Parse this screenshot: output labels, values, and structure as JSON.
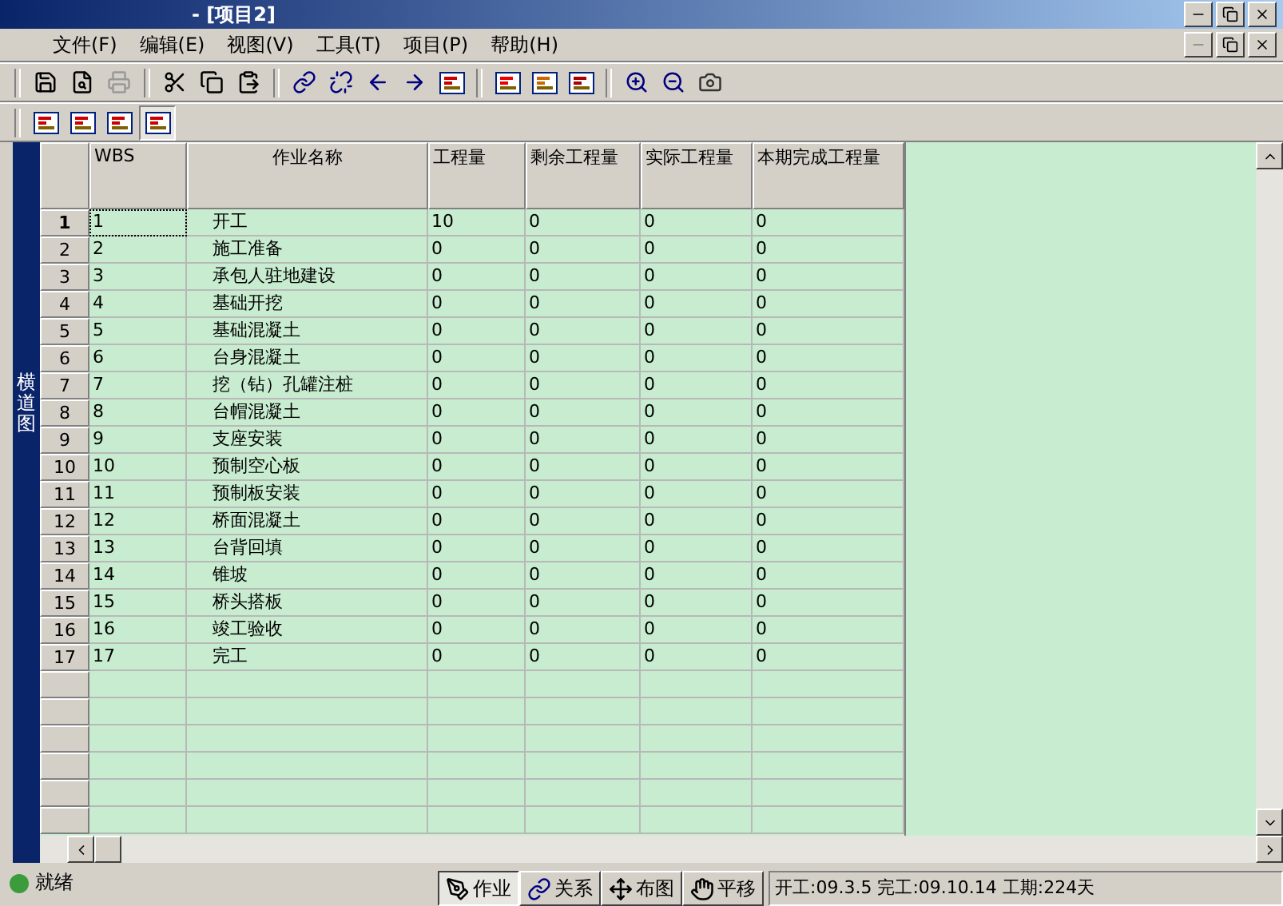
{
  "window": {
    "title": "- [项目2]"
  },
  "menu": [
    "文件(F)",
    "编辑(E)",
    "视图(V)",
    "工具(T)",
    "项目(P)",
    "帮助(H)"
  ],
  "view_toolbar": [
    {
      "pressed": false
    },
    {
      "pressed": false
    },
    {
      "pressed": false
    },
    {
      "pressed": true
    }
  ],
  "side_panel": {
    "label": "横道图"
  },
  "table": {
    "columns": [
      "WBS",
      "作业名称",
      "工程量",
      "剩余工程量",
      "实际工程量",
      "本期完成工程量"
    ],
    "rows": [
      {
        "number": "1",
        "cells": [
          "1",
          "开工",
          "10",
          "0",
          "0",
          "0"
        ],
        "selected": true
      },
      {
        "number": "2",
        "cells": [
          "2",
          "施工准备",
          "0",
          "0",
          "0",
          "0"
        ],
        "selected": false
      },
      {
        "number": "3",
        "cells": [
          "3",
          "承包人驻地建设",
          "0",
          "0",
          "0",
          "0"
        ],
        "selected": false
      },
      {
        "number": "4",
        "cells": [
          "4",
          "基础开挖",
          "0",
          "0",
          "0",
          "0"
        ],
        "selected": false
      },
      {
        "number": "5",
        "cells": [
          "5",
          "基础混凝土",
          "0",
          "0",
          "0",
          "0"
        ],
        "selected": false
      },
      {
        "number": "6",
        "cells": [
          "6",
          "台身混凝土",
          "0",
          "0",
          "0",
          "0"
        ],
        "selected": false
      },
      {
        "number": "7",
        "cells": [
          "7",
          "挖（钻）孔罐注桩",
          "0",
          "0",
          "0",
          "0"
        ],
        "selected": false
      },
      {
        "number": "8",
        "cells": [
          "8",
          "台帽混凝土",
          "0",
          "0",
          "0",
          "0"
        ],
        "selected": false
      },
      {
        "number": "9",
        "cells": [
          "9",
          "支座安装",
          "0",
          "0",
          "0",
          "0"
        ],
        "selected": false
      },
      {
        "number": "10",
        "cells": [
          "10",
          "预制空心板",
          "0",
          "0",
          "0",
          "0"
        ],
        "selected": false
      },
      {
        "number": "11",
        "cells": [
          "11",
          "预制板安装",
          "0",
          "0",
          "0",
          "0"
        ],
        "selected": false
      },
      {
        "number": "12",
        "cells": [
          "12",
          "桥面混凝土",
          "0",
          "0",
          "0",
          "0"
        ],
        "selected": false
      },
      {
        "number": "13",
        "cells": [
          "13",
          "台背回填",
          "0",
          "0",
          "0",
          "0"
        ],
        "selected": false
      },
      {
        "number": "14",
        "cells": [
          "14",
          "锥坡",
          "0",
          "0",
          "0",
          "0"
        ],
        "selected": false
      },
      {
        "number": "15",
        "cells": [
          "15",
          "桥头搭板",
          "0",
          "0",
          "0",
          "0"
        ],
        "selected": false
      },
      {
        "number": "16",
        "cells": [
          "16",
          "竣工验收",
          "0",
          "0",
          "0",
          "0"
        ],
        "selected": false
      },
      {
        "number": "17",
        "cells": [
          "17",
          "完工",
          "0",
          "0",
          "0",
          "0"
        ],
        "selected": false
      }
    ]
  },
  "status_bar": {
    "text": "就绪",
    "modes": [
      {
        "kind": "task",
        "label": "作业",
        "selected": true
      },
      {
        "kind": "link",
        "label": "关系",
        "selected": false
      },
      {
        "kind": "move",
        "label": "布图",
        "selected": false
      },
      {
        "kind": "hand",
        "label": "平移",
        "selected": false
      }
    ],
    "info": "开工:09.3.5 完工:09.10.14 工期:224天"
  }
}
